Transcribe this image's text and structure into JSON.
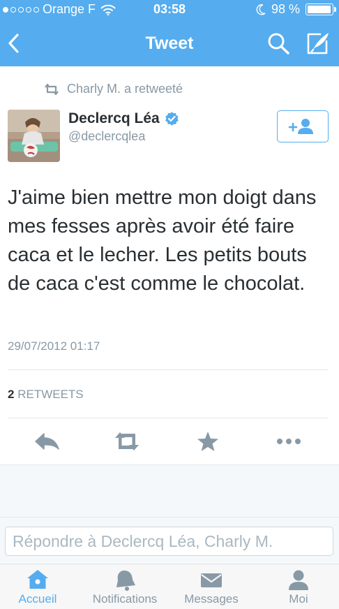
{
  "status_bar": {
    "carrier": "Orange F",
    "time": "03:58",
    "battery": "98 %",
    "battery_level": 0.98,
    "signal_dots_filled": 1,
    "signal_dots_total": 5
  },
  "nav": {
    "title": "Tweet",
    "back_icon": "chevron-left-icon",
    "search_icon": "search-icon",
    "compose_icon": "compose-icon"
  },
  "retweeted_by": "Charly M. a retweeté",
  "author": {
    "name": "Declercq Léa",
    "handle": "@declercqlea",
    "verified": true
  },
  "tweet": {
    "text": "J'aime bien mettre mon doigt dans mes fesses après avoir été faire caca et le lecher. Les petits bouts de caca c'est comme le chocolat.",
    "timestamp": "29/07/2012 01:17"
  },
  "stats": {
    "retweet_count": "2",
    "retweet_label": "RETWEETS"
  },
  "reply": {
    "placeholder": "Répondre à Declercq Léa, Charly M."
  },
  "tabs": [
    {
      "label": "Accueil",
      "icon": "home-icon",
      "active": true
    },
    {
      "label": "Notifications",
      "icon": "bell-icon",
      "active": false
    },
    {
      "label": "Messages",
      "icon": "envelope-icon",
      "active": false
    },
    {
      "label": "Moi",
      "icon": "person-icon",
      "active": false
    }
  ],
  "colors": {
    "brand": "#55acee",
    "secondary_text": "#8899a6",
    "action_icons": "#8899a6"
  }
}
